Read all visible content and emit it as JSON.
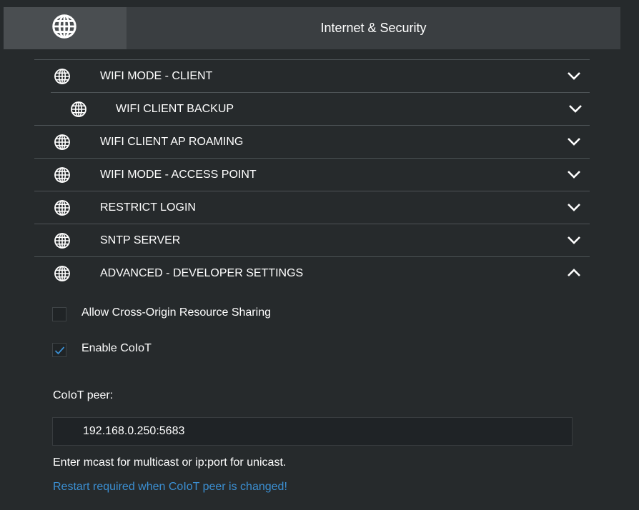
{
  "header": {
    "title": "Internet & Security",
    "icon": "globe-icon"
  },
  "sections": [
    {
      "label": "WIFI MODE - CLIENT",
      "icon": "globe-icon",
      "state": "collapsed"
    },
    {
      "label": "WIFI CLIENT BACKUP",
      "icon": "globe-icon",
      "state": "collapsed"
    },
    {
      "label": "WIFI CLIENT AP ROAMING",
      "icon": "globe-icon",
      "state": "collapsed"
    },
    {
      "label": "WIFI MODE - ACCESS POINT",
      "icon": "globe-icon",
      "state": "collapsed"
    },
    {
      "label": "RESTRICT LOGIN",
      "icon": "globe-icon",
      "state": "collapsed"
    },
    {
      "label": "SNTP SERVER",
      "icon": "globe-icon",
      "state": "collapsed"
    },
    {
      "label": "ADVANCED - DEVELOPER SETTINGS",
      "icon": "globe-icon",
      "state": "expanded"
    }
  ],
  "advanced": {
    "cors": {
      "label": "Allow Cross-Origin Resource Sharing",
      "checked": false
    },
    "coiot": {
      "label": "Enable CoIoT",
      "checked": true
    },
    "peer_label": "CoIoT peer:",
    "peer_value": "192.168.0.250:5683",
    "help_text": "Enter mcast for multicast or ip:port for unicast.",
    "warning_text": "Restart required when CoIoT peer is changed!"
  },
  "colors": {
    "background": "#262a2c",
    "header_bg": "#3a3e41",
    "header_icon_bg": "#4a4e51",
    "divider": "#4d5356",
    "accent_blue": "#3b8fd2",
    "text": "#ffffff"
  }
}
